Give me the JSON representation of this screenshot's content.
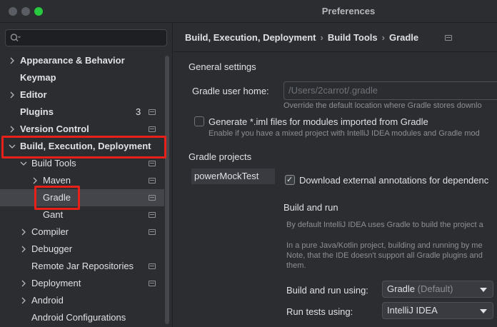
{
  "window": {
    "title": "Preferences"
  },
  "search": {
    "placeholder": ""
  },
  "sidebar": {
    "items": [
      {
        "label": "Appearance & Behavior"
      },
      {
        "label": "Keymap"
      },
      {
        "label": "Editor"
      },
      {
        "label": "Plugins",
        "badge": "3"
      },
      {
        "label": "Version Control"
      },
      {
        "label": "Build, Execution, Deployment"
      },
      {
        "label": "Build Tools"
      },
      {
        "label": "Maven"
      },
      {
        "label": "Gradle"
      },
      {
        "label": "Gant"
      },
      {
        "label": "Compiler"
      },
      {
        "label": "Debugger"
      },
      {
        "label": "Remote Jar Repositories"
      },
      {
        "label": "Deployment"
      },
      {
        "label": "Android"
      },
      {
        "label": "Android Configurations"
      }
    ]
  },
  "breadcrumb": {
    "items": [
      "Build, Execution, Deployment",
      "Build Tools",
      "Gradle"
    ],
    "separator": "›"
  },
  "general": {
    "heading": "General settings",
    "gradle_home_label": "Gradle user home:",
    "gradle_home_value": "/Users/2carrot/.gradle",
    "gradle_home_hint": "Override the default location where Gradle stores downlo",
    "generate_iml_label": "Generate *.iml files for modules imported from Gradle",
    "generate_iml_hint": "Enable if you have a mixed project with IntelliJ IDEA modules and Gradle mod"
  },
  "projects": {
    "heading": "Gradle projects",
    "list": [
      "powerMockTest"
    ],
    "download_annotations_label": "Download external annotations for dependenc",
    "build_run_heading": "Build and run",
    "build_run_hint1": "By default IntelliJ IDEA uses Gradle to build the project a",
    "build_run_hint2": "In a pure Java/Kotlin project, building and running by me",
    "build_run_hint3": "Note, that the IDE doesn't support all Gradle plugins and",
    "build_run_hint4": "them.",
    "build_using_label": "Build and run using:",
    "build_using_value": "Gradle",
    "build_using_suffix": "(Default)",
    "run_tests_label": "Run tests using:",
    "run_tests_value": "IntelliJ IDEA"
  },
  "colors": {
    "highlight": "#e8201a",
    "selection": "#43454a"
  },
  "icons": [
    "search-icon",
    "chevron-right-icon",
    "chevron-down-icon",
    "settings-scope-icon",
    "checkbox-check-icon",
    "dropdown-caret-icon"
  ]
}
